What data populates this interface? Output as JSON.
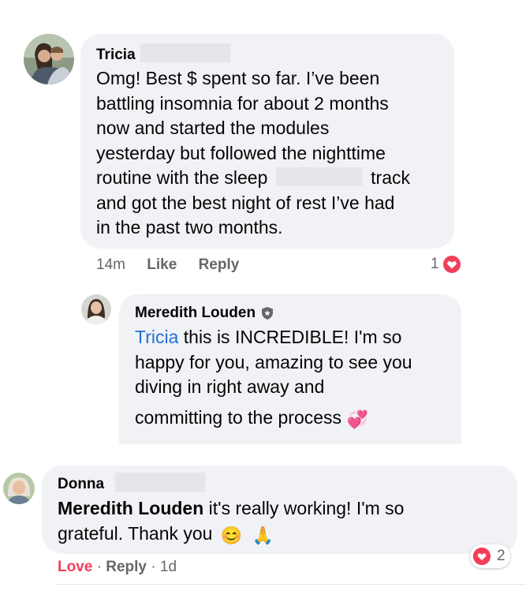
{
  "comments": [
    {
      "author": "Tricia",
      "lines": [
        "Omg!  Best $ spent so far.  I’ve been",
        "battling insomnia for about  2 months",
        "now and started the modules",
        "yesterday but followed the nighttime",
        "routine with the sleep",
        "track",
        "and got the best night of rest I’ve had",
        "in the past two months."
      ],
      "time": "14m",
      "like_label": "Like",
      "reply_label": "Reply",
      "reaction_count": "1"
    },
    {
      "author": "Meredith Louden",
      "mention": "Tricia",
      "lines": [
        " this is INCREDIBLE! I'm so",
        "happy for you, amazing to see you",
        "diving in right away and",
        "committing to the process"
      ],
      "emoji": "💞"
    },
    {
      "author": "Donna",
      "mention": "Meredith Louden",
      "lines": [
        " it's really working! I'm so",
        "grateful. Thank you"
      ],
      "emojis": [
        "😊",
        "🙏"
      ],
      "love_label": "Love",
      "reply_label": "Reply",
      "time": "1d",
      "reaction_count": "2"
    }
  ],
  "colors": {
    "bubble": "#f0f2f5",
    "mention": "#216fdb",
    "love": "#f33e58",
    "meta": "#65676b"
  },
  "icons": [
    "heart-icon",
    "admin-shield-icon"
  ]
}
